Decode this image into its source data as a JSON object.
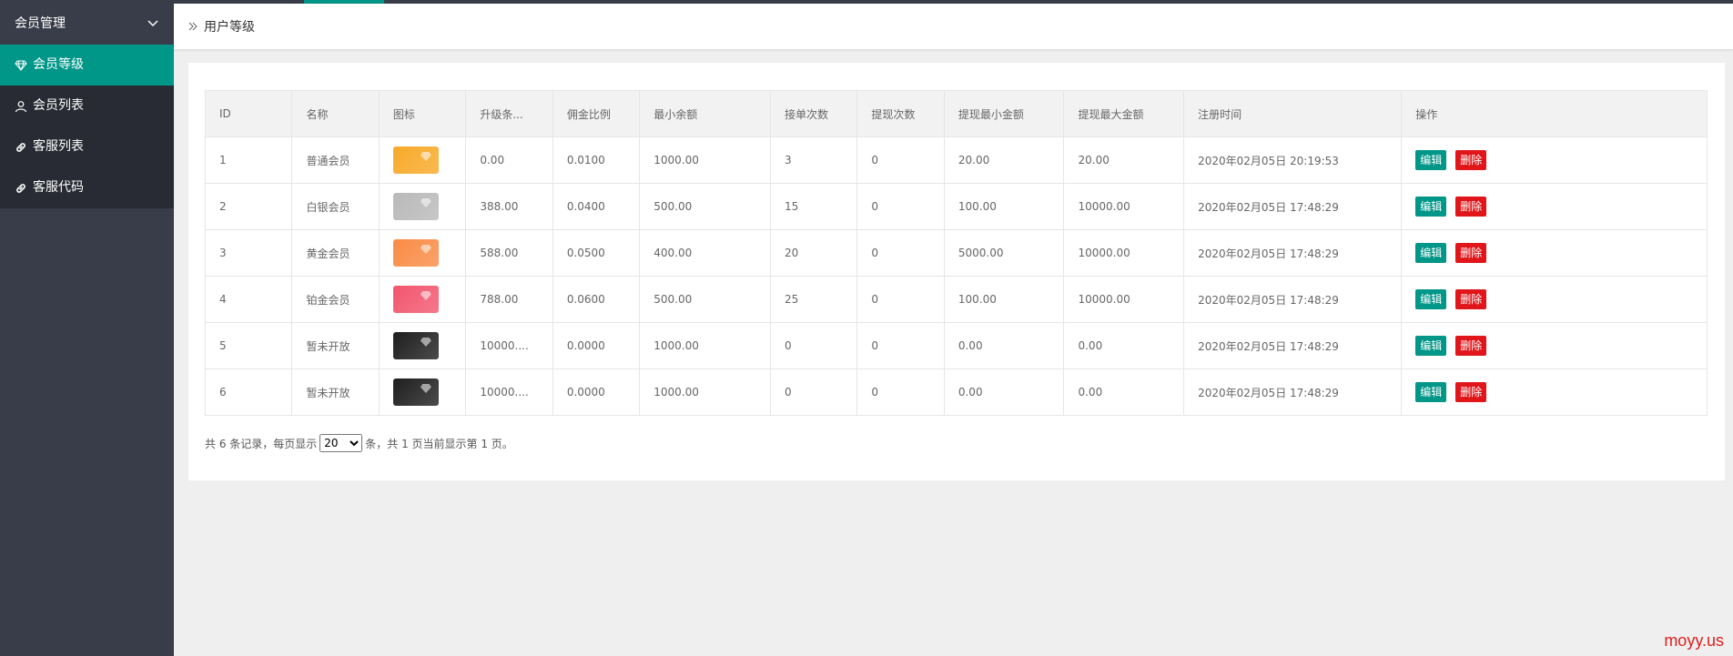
{
  "sidebar": {
    "menu_title": "会员管理",
    "items": [
      {
        "label": "会员等级",
        "icon": "diamond-icon",
        "active": true
      },
      {
        "label": "会员列表",
        "icon": "user-icon",
        "active": false
      },
      {
        "label": "客服列表",
        "icon": "link-icon",
        "active": false
      },
      {
        "label": "客服代码",
        "icon": "link-icon",
        "active": false
      }
    ]
  },
  "header": {
    "breadcrumb": "用户等级"
  },
  "table": {
    "columns": [
      "ID",
      "名称",
      "图标",
      "升级条...",
      "佣金比例",
      "最小余额",
      "接单次数",
      "提现次数",
      "提现最小金额",
      "提现最大金额",
      "注册时间",
      "操作"
    ],
    "rows": [
      {
        "id": "1",
        "name": "普通会员",
        "icon_color": "#f7a928",
        "upgrade": "0.00",
        "commission": "0.0100",
        "min_balance": "1000.00",
        "orders": "3",
        "withdraws": "0",
        "wd_min": "20.00",
        "wd_max": "20.00",
        "time": "2020年02月05日 20:19:53"
      },
      {
        "id": "2",
        "name": "白银会员",
        "icon_color": "#b9b9b9",
        "upgrade": "388.00",
        "commission": "0.0400",
        "min_balance": "500.00",
        "orders": "15",
        "withdraws": "0",
        "wd_min": "100.00",
        "wd_max": "10000.00",
        "time": "2020年02月05日 17:48:29"
      },
      {
        "id": "3",
        "name": "黄金会员",
        "icon_color": "#f98b45",
        "upgrade": "588.00",
        "commission": "0.0500",
        "min_balance": "400.00",
        "orders": "20",
        "withdraws": "0",
        "wd_min": "5000.00",
        "wd_max": "10000.00",
        "time": "2020年02月05日 17:48:29"
      },
      {
        "id": "4",
        "name": "铂金会员",
        "icon_color": "#f2566e",
        "upgrade": "788.00",
        "commission": "0.0600",
        "min_balance": "500.00",
        "orders": "25",
        "withdraws": "0",
        "wd_min": "100.00",
        "wd_max": "10000.00",
        "time": "2020年02月05日 17:48:29"
      },
      {
        "id": "5",
        "name": "暂未开放",
        "icon_color": "#1e1e1e",
        "upgrade": "10000....",
        "commission": "0.0000",
        "min_balance": "1000.00",
        "orders": "0",
        "withdraws": "0",
        "wd_min": "0.00",
        "wd_max": "0.00",
        "time": "2020年02月05日 17:48:29"
      },
      {
        "id": "6",
        "name": "暂未开放",
        "icon_color": "#1e1e1e",
        "upgrade": "10000....",
        "commission": "0.0000",
        "min_balance": "1000.00",
        "orders": "0",
        "withdraws": "0",
        "wd_min": "0.00",
        "wd_max": "0.00",
        "time": "2020年02月05日 17:48:29"
      }
    ],
    "edit_label": "编辑",
    "delete_label": "删除"
  },
  "pager": {
    "prefix": "共 6 条记录，每页显示",
    "page_size": "20",
    "suffix": "条，共 1 页当前显示第 1 页。"
  },
  "watermark": "moyy.us",
  "colors": {
    "accent": "#009688",
    "danger": "#e0161a",
    "sidebar": "#393D49"
  }
}
